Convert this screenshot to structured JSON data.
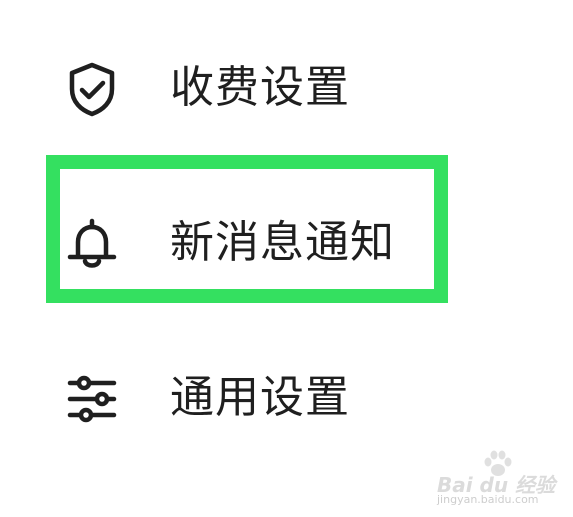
{
  "menu": {
    "items": [
      {
        "label": "收费设置",
        "icon": "shield-check-icon"
      },
      {
        "label": "新消息通知",
        "icon": "bell-icon"
      },
      {
        "label": "通用设置",
        "icon": "sliders-icon"
      }
    ]
  },
  "highlight": {
    "color": "#34e060",
    "target": "新消息通知"
  },
  "watermark": {
    "brand": "Bai du 经验",
    "site": "jingyan.baidu.com",
    "icon": "paw-icon"
  },
  "colors": {
    "text": "#1f1f1f",
    "background": "#ffffff",
    "highlight": "#34e060"
  }
}
